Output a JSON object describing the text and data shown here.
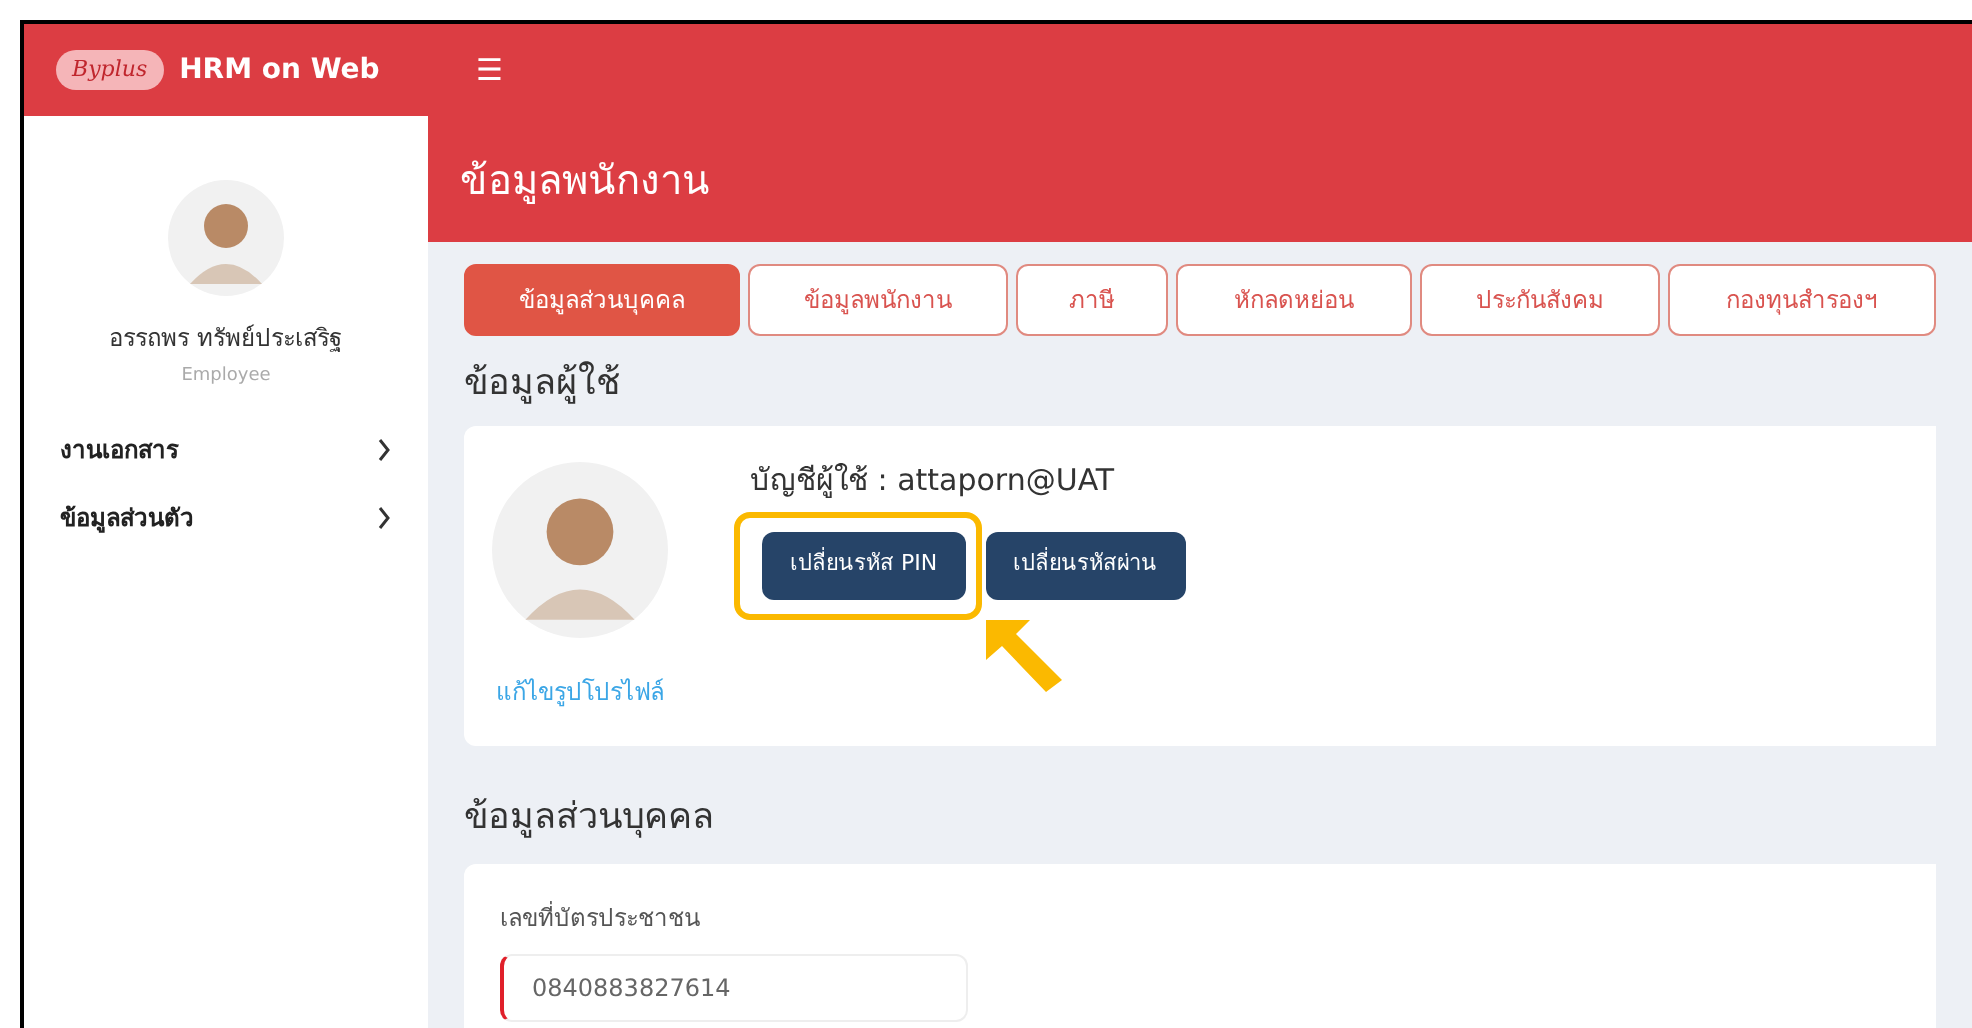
{
  "topbar": {
    "logo_text": "Byplus",
    "app_name": "HRM on Web",
    "menu_icon": "☰"
  },
  "sidebar": {
    "user_name": "อรรถพร ทรัพย์ประเสริฐ",
    "role": "Employee",
    "items": [
      {
        "label": "งานเอกสาร",
        "expanded": false
      },
      {
        "label": "ข้อมูลส่วนตัว",
        "expanded": false
      }
    ]
  },
  "page_title": "ข้อมูลพนักงาน",
  "tabs": [
    {
      "label": "ข้อมูลส่วนบุคคล",
      "selected": true
    },
    {
      "label": "ข้อมูลพนักงาน",
      "selected": false
    },
    {
      "label": "ภาษี",
      "selected": false
    },
    {
      "label": "หักลดหย่อน",
      "selected": false
    },
    {
      "label": "ประกันสังคม",
      "selected": false
    },
    {
      "label": "กองทุนสำรองฯ",
      "selected": false
    }
  ],
  "user_section": {
    "heading": "ข้อมูลผู้ใช้",
    "account": "บัญชีผู้ใช้ : attaporn@UAT",
    "edit_photo": "แก้ไขรูปโปรไฟล์",
    "buttons": [
      {
        "label": "เปลี่ยนรหัส PIN",
        "highlighted": true
      },
      {
        "label": "เปลี่ยนรหัสผ่าน",
        "highlighted": false
      }
    ]
  },
  "personal_section": {
    "heading": "ข้อมูลส่วนบุคคล",
    "fields": [
      {
        "label": "เลขที่บัตรประชาชน",
        "value": "0840883827614"
      }
    ]
  }
}
